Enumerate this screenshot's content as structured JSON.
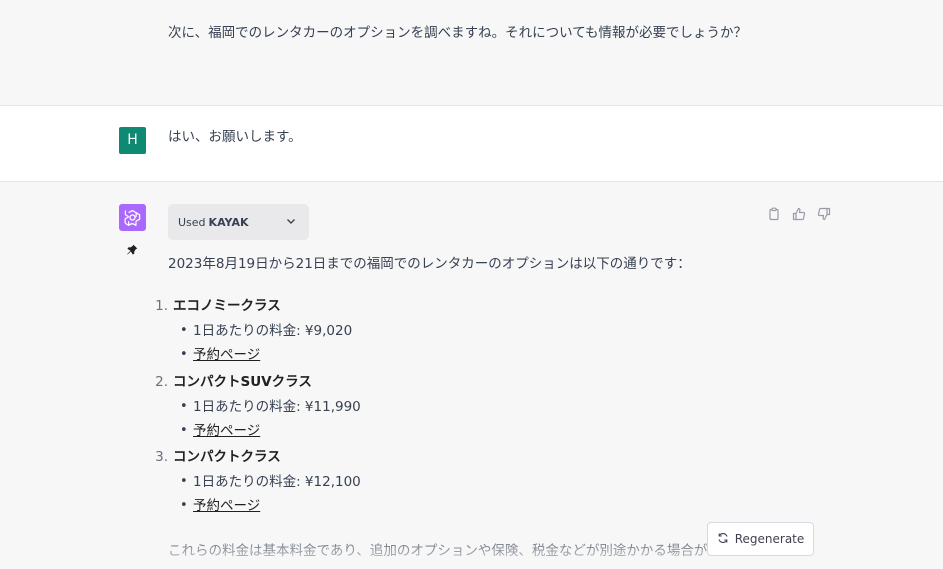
{
  "previous_message": {
    "text": "次に、福岡でのレンタカーのオプションを調べますね。それについても情報が必要でしょうか？"
  },
  "user_message": {
    "avatar_letter": "H",
    "avatar_color": "#0f8a72",
    "text": "はい、お願いします。"
  },
  "assistant_message": {
    "avatar_color": "#ab68ff",
    "plugin_used_prefix": "Used",
    "plugin_name": "KAYAK",
    "intro": "2023年8月19日から21日までの福岡でのレンタカーのオプションは以下の通りです：",
    "options": [
      {
        "num": "1.",
        "title": "エコノミークラス",
        "price": "1日あたりの料金: ¥9,020",
        "link": "予約ページ"
      },
      {
        "num": "2.",
        "title": "コンパクトSUVクラス",
        "price": "1日あたりの料金: ¥11,990",
        "link": "予約ページ"
      },
      {
        "num": "3.",
        "title": "コンパクトクラス",
        "price": "1日あたりの料金: ¥12,100",
        "link": "予約ページ"
      }
    ],
    "footer": "これらの料金は基本料金であり、追加のオプションや保険、税金などが別途かかる場合が"
  },
  "regenerate_label": "Regenerate"
}
